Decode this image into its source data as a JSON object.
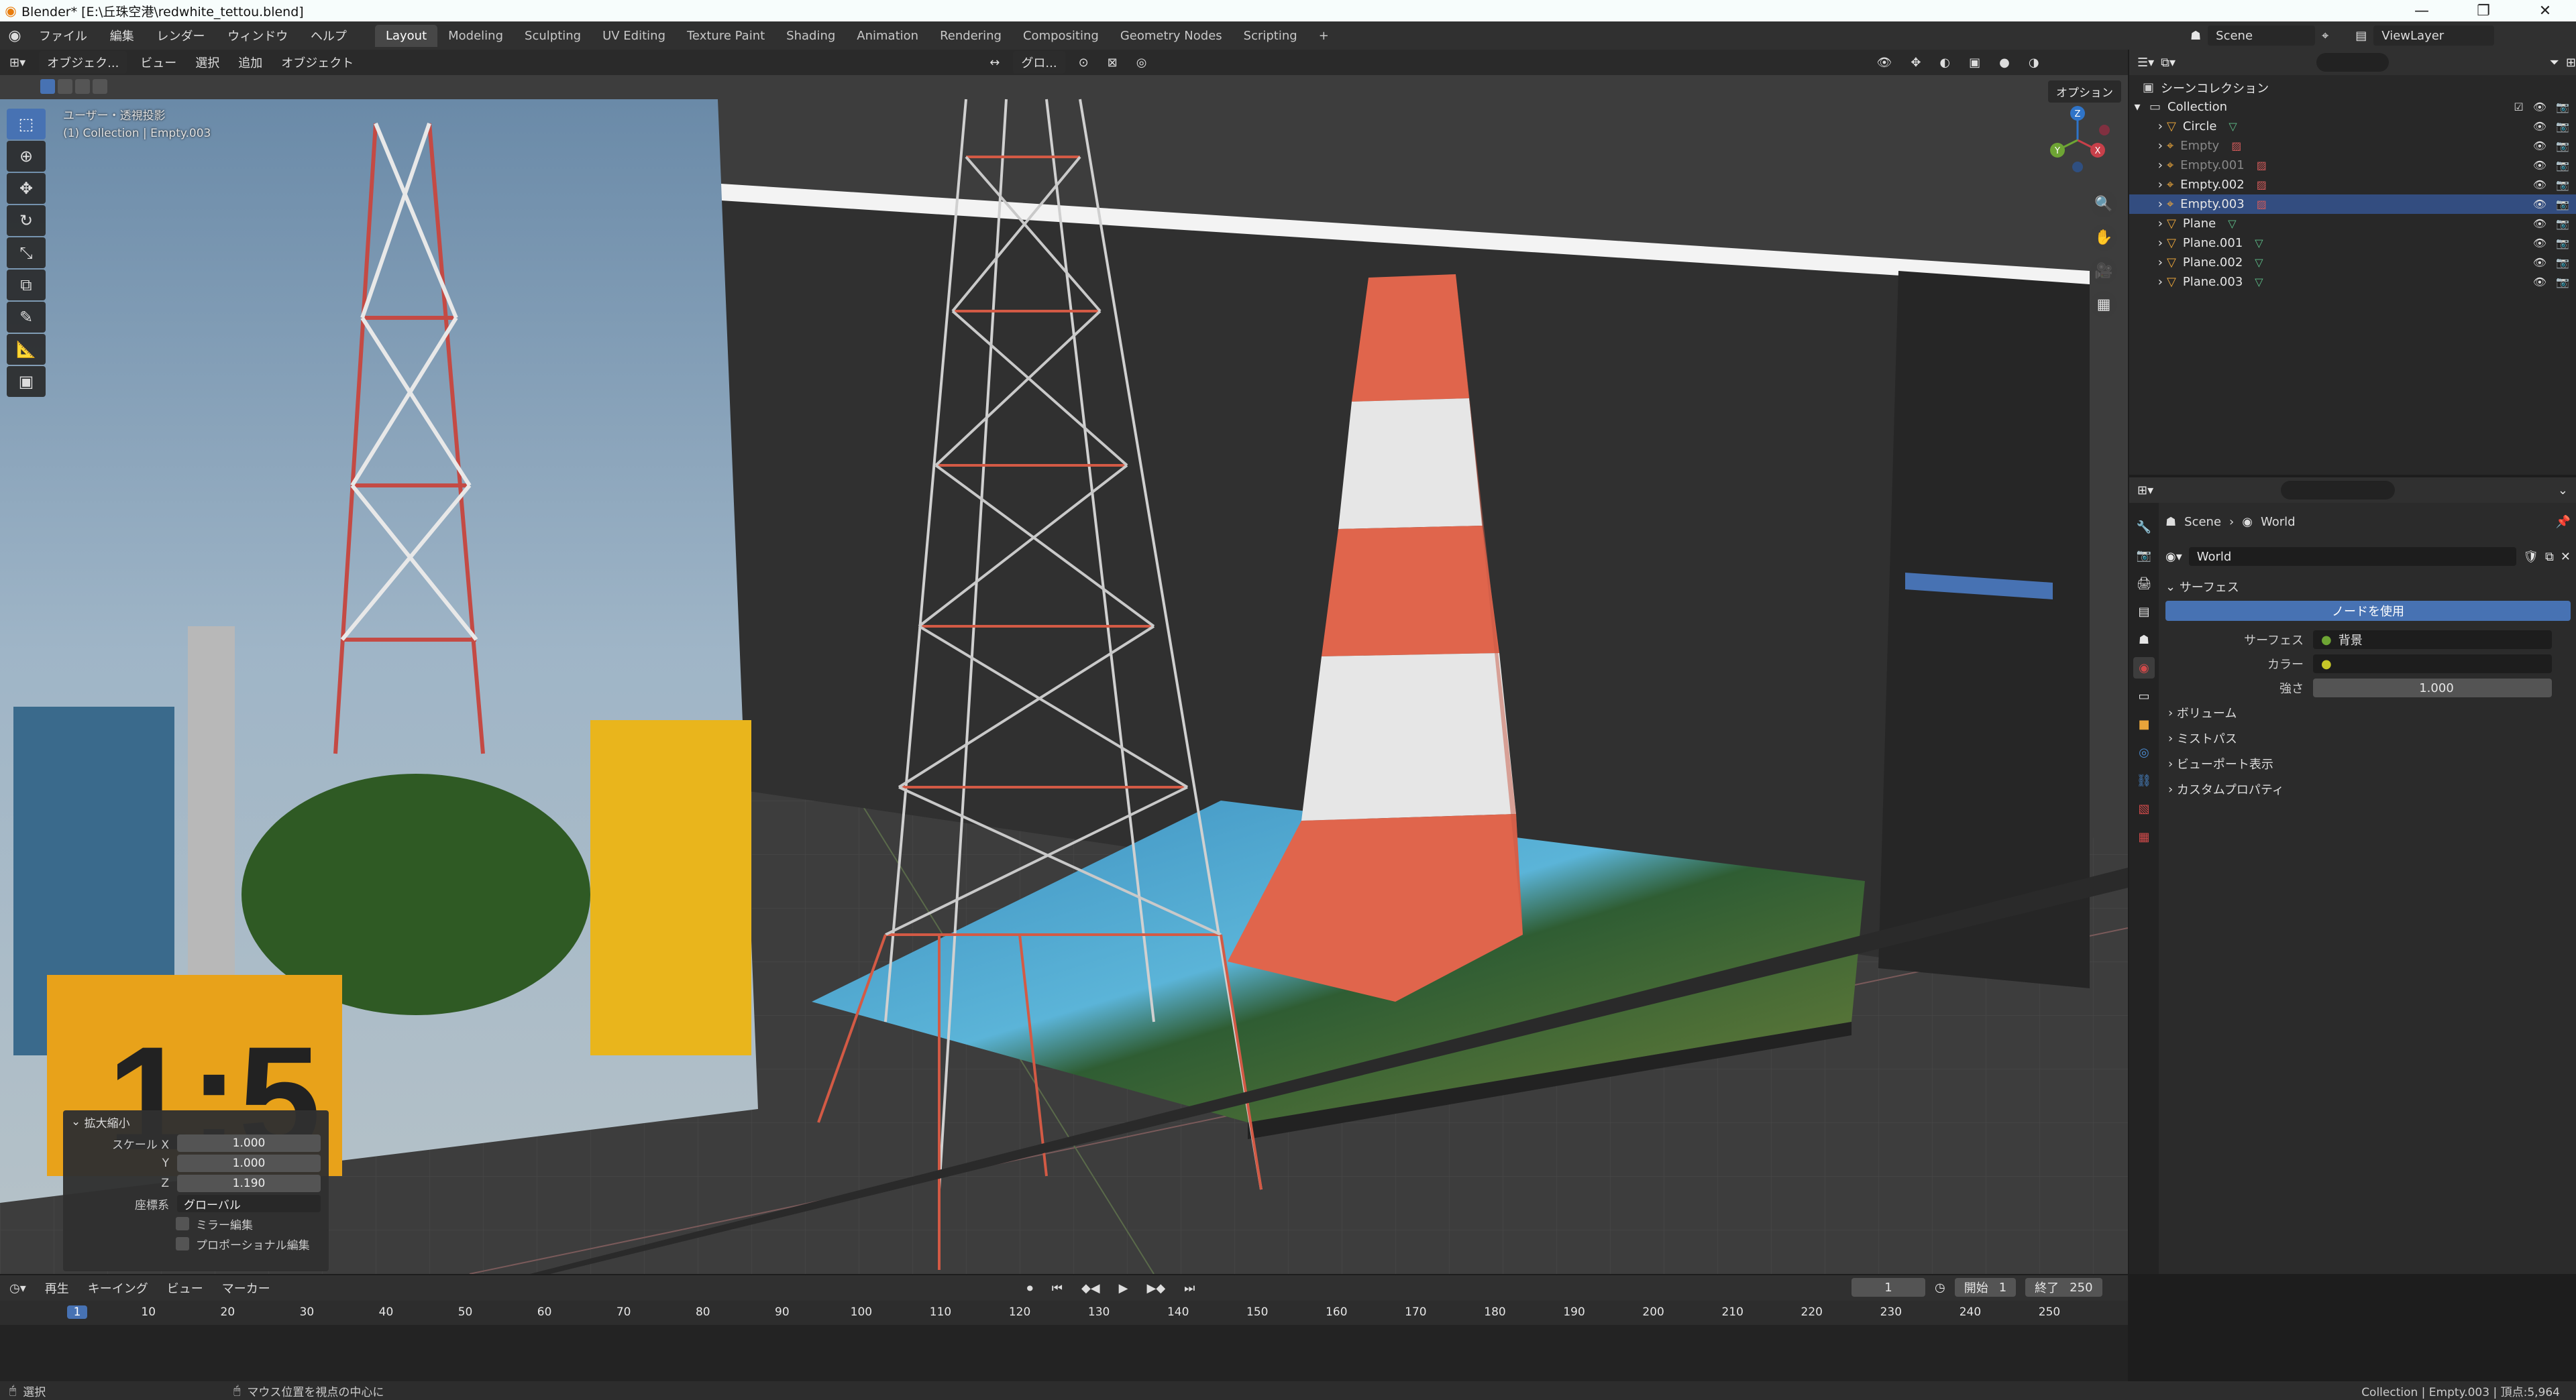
{
  "window": {
    "title": "Blender* [E:\\丘珠空港\\redwhite_tettou.blend]",
    "controls": [
      "—",
      "❐",
      "✕"
    ]
  },
  "menu": [
    "ファイル",
    "編集",
    "レンダー",
    "ウィンドウ",
    "ヘルプ"
  ],
  "workspace_tabs": [
    "Layout",
    "Modeling",
    "Sculpting",
    "UV Editing",
    "Texture Paint",
    "Shading",
    "Animation",
    "Rendering",
    "Compositing",
    "Geometry Nodes",
    "Scripting",
    "+"
  ],
  "active_tab": "Layout",
  "scene": {
    "scene_name": "Scene",
    "view_layer": "ViewLayer"
  },
  "viewport": {
    "mode": "オブジェク...",
    "menu": [
      "ビュー",
      "選択",
      "追加",
      "オブジェクト"
    ],
    "transform_orientation": "グロ...",
    "options": "オプション",
    "info_line1": "ユーザー・透視投影",
    "info_line2": "(1) Collection | Empty.003",
    "gizmo_axes": [
      "X",
      "Y",
      "Z"
    ]
  },
  "redo_panel": {
    "title": "拡大縮小",
    "scale_label": "スケール X",
    "y_label": "Y",
    "z_label": "Z",
    "x": "1.000",
    "y": "1.000",
    "z": "1.190",
    "orientation_label": "座標系",
    "orientation_value": "グローバル",
    "mirror": "ミラー編集",
    "proportional": "プロポーショナル編集"
  },
  "outliner": {
    "root": "シーンコレクション",
    "collection": "Collection",
    "items": [
      {
        "name": "Circle",
        "type": "mesh",
        "dim": false,
        "selected": false
      },
      {
        "name": "Empty",
        "type": "empty",
        "dim": true,
        "selected": false
      },
      {
        "name": "Empty.001",
        "type": "empty",
        "dim": true,
        "selected": false
      },
      {
        "name": "Empty.002",
        "type": "empty",
        "dim": false,
        "selected": false
      },
      {
        "name": "Empty.003",
        "type": "empty",
        "dim": false,
        "selected": true
      },
      {
        "name": "Plane",
        "type": "mesh",
        "dim": false,
        "selected": false
      },
      {
        "name": "Plane.001",
        "type": "mesh",
        "dim": false,
        "selected": false
      },
      {
        "name": "Plane.002",
        "type": "mesh",
        "dim": false,
        "selected": false
      },
      {
        "name": "Plane.003",
        "type": "mesh",
        "dim": false,
        "selected": false
      }
    ]
  },
  "properties": {
    "breadcrumb_scene": "Scene",
    "breadcrumb_world": "World",
    "world_name": "World",
    "surface_panel": "サーフェス",
    "use_nodes": "ノードを使用",
    "surface_label": "サーフェス",
    "surface_value": "背景",
    "color_label": "カラー",
    "strength_label": "強さ",
    "strength_value": "1.000",
    "volume": "ボリューム",
    "mist": "ミストパス",
    "viewport_display": "ビューポート表示",
    "custom_props": "カスタムプロパティ"
  },
  "timeline": {
    "menu": [
      "再生",
      "キーイング",
      "ビュー",
      "マーカー"
    ],
    "current_frame": "1",
    "start_label": "開始",
    "start": "1",
    "end_label": "終了",
    "end": "250",
    "ticks": [
      "1",
      "10",
      "20",
      "30",
      "40",
      "50",
      "60",
      "70",
      "80",
      "90",
      "100",
      "110",
      "120",
      "130",
      "140",
      "150",
      "160",
      "170",
      "180",
      "190",
      "200",
      "210",
      "220",
      "230",
      "240",
      "250"
    ]
  },
  "status": {
    "left": "選択",
    "middle": "マウス位置を視点の中心に",
    "right": "Collection | Empty.003 | 頂点:5,964"
  },
  "colors": {
    "accent": "#4772b3",
    "selected_row": "#334d80",
    "tower_red": "#e0654c",
    "tower_white": "#e6e6e6"
  }
}
